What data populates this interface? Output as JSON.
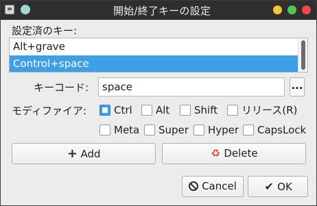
{
  "window": {
    "title": "開始/終了キーの設定",
    "icons": [
      "app-icon",
      "pin-icon",
      "minimize-icon",
      "maximize-icon",
      "close-icon"
    ]
  },
  "keys": {
    "label": "設定済のキー:",
    "items": [
      "Alt+grave",
      "Control+space"
    ],
    "selected_index": 1
  },
  "keycode": {
    "label": "キーコード:",
    "value": "space",
    "browse_label": "..."
  },
  "modifiers": {
    "label": "モディファイア:",
    "items": [
      {
        "label": "Ctrl",
        "checked": true
      },
      {
        "label": "Alt",
        "checked": false
      },
      {
        "label": "Shift",
        "checked": false
      },
      {
        "label": "リリース(R)",
        "checked": false
      },
      {
        "label": "Meta",
        "checked": false
      },
      {
        "label": "Super",
        "checked": false
      },
      {
        "label": "Hyper",
        "checked": false
      },
      {
        "label": "CapsLock",
        "checked": false
      }
    ]
  },
  "buttons": {
    "add": "Add",
    "delete": "Delete",
    "cancel": "Cancel",
    "ok": "OK"
  },
  "colors": {
    "selection": "#3d9fe6",
    "titlebar": "#2f2f2f",
    "minimize": "#f5c33b",
    "maximize": "#4ec852",
    "close": "#ef4b4b"
  }
}
